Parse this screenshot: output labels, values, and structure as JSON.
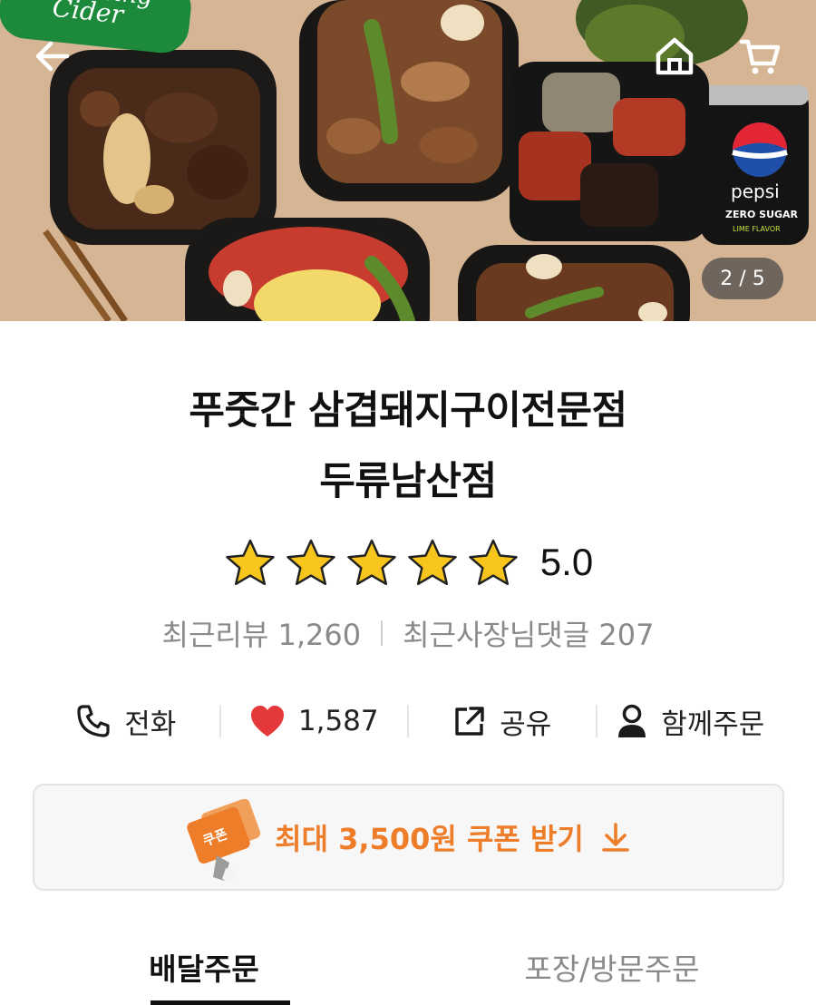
{
  "hero": {
    "pager": "2 / 5",
    "can_brand_1": "pepsi",
    "can_text_1": "ZERO SUGAR",
    "can_text_2": "LIME FLAVOR",
    "can_brand_2": "Cider",
    "can_text_3": "asing"
  },
  "store": {
    "name_line1": "푸줏간 삼겹돼지구이전문점",
    "name_line2": "두류남산점",
    "rating_value": "5.0",
    "star_count": 5,
    "star_color": "#f7c51b",
    "recent_reviews": "최근리뷰 1,260",
    "owner_replies": "최근사장님댓글 207"
  },
  "actions": {
    "call": "전화",
    "likes": "1,587",
    "share": "공유",
    "group_order": "함께주문"
  },
  "coupon": {
    "label": "최대 3,500원 쿠폰 받기",
    "badge": "쿠폰",
    "accent": "#ee7d2a"
  },
  "tabs": {
    "delivery": "배달주문",
    "pickup": "포장/방문주문"
  },
  "icons": [
    "back-arrow-icon",
    "home-icon",
    "cart-icon",
    "phone-icon",
    "heart-icon",
    "share-icon",
    "person-icon",
    "coupon-icon",
    "download-arrow-icon"
  ]
}
